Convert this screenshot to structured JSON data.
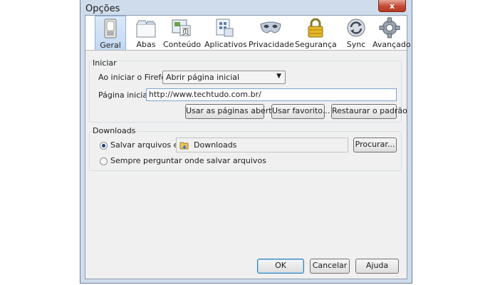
{
  "window": {
    "title": "Opções",
    "close_glyph": "x"
  },
  "toolbar": {
    "panes": [
      {
        "label": "Geral",
        "icon": "switch-icon",
        "selected": true
      },
      {
        "label": "Abas",
        "icon": "tabs-icon"
      },
      {
        "label": "Conteúdo",
        "icon": "content-icon"
      },
      {
        "label": "Aplicativos",
        "icon": "applications-icon"
      },
      {
        "label": "Privacidade",
        "icon": "mask-icon"
      },
      {
        "label": "Segurança",
        "icon": "padlock-icon"
      },
      {
        "label": "Sync",
        "icon": "sync-icon"
      },
      {
        "label": "Avançado",
        "icon": "gear-icon"
      }
    ]
  },
  "startup": {
    "group_title": "Iniciar",
    "on_start_label": "Ao iniciar o Firefox:",
    "on_start_value": "Abrir página inicial",
    "homepage_label": "Página inicial:",
    "homepage_value": "http://www.techtudo.com.br/",
    "use_current_pages": "Usar as páginas abertas",
    "use_bookmark": "Usar favorito...",
    "restore_default": "Restaurar o padrão"
  },
  "downloads": {
    "group_title": "Downloads",
    "save_to_label": "Salvar arquivos em:",
    "save_to_folder": "Downloads",
    "browse_button": "Procurar...",
    "always_ask_label": "Sempre perguntar onde salvar arquivos",
    "save_to_checked": true
  },
  "footer": {
    "ok": "OK",
    "cancel": "Cancelar",
    "help": "Ajuda"
  },
  "colors": {
    "window_frame": "#cfdcec",
    "selected_pane": "#c3d9f2",
    "close_button": "#c24a34"
  }
}
